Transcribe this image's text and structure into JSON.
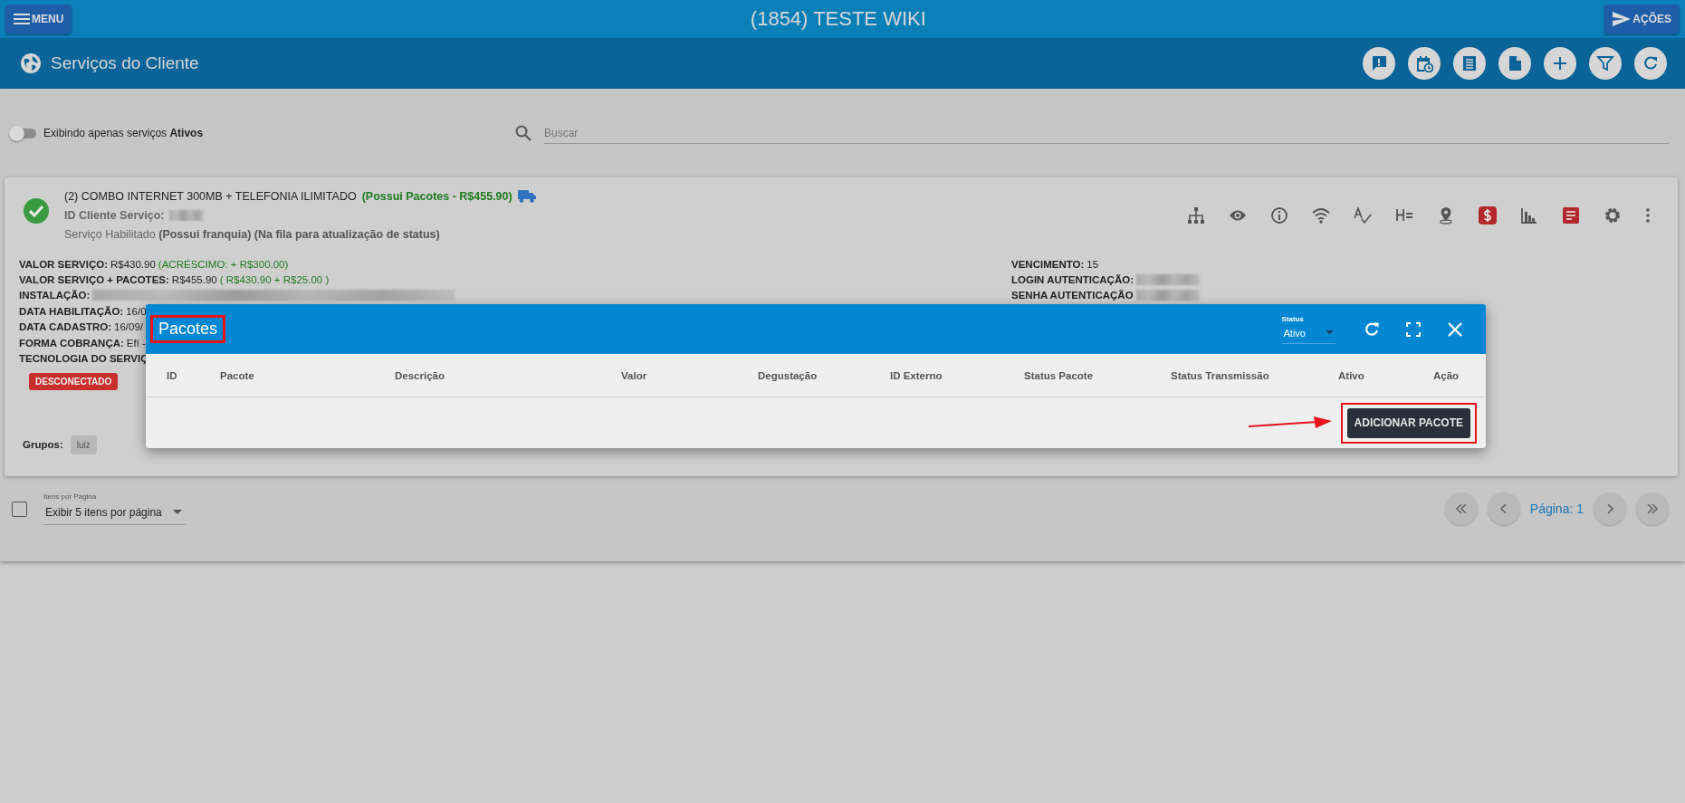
{
  "top_bar": {
    "menu_button": "MENU",
    "title": "(1854) TESTE WIKI",
    "actions_button": "AÇÕES"
  },
  "header": {
    "title": "Serviços do Cliente"
  },
  "filters": {
    "toggle": {
      "label": "Exibindo apenas serviços **Ativos**",
      "on": false
    },
    "search": {
      "placeholder": "Buscar"
    }
  },
  "service": {
    "title": "(2) COMBO INTERNET 300MB + TELEFONIA ILIMITADO",
    "packages_note": "(Possui Pacotes - R$455.90)",
    "id_label": "ID Cliente Serviço:",
    "status_text": "Serviço Habilitado **(Possui franquia) (Na fila para atualização de status)**",
    "left_details": [
      {
        "label": "VALOR SERVIÇO:",
        "value": "R$430.90",
        "note": "(ACRÉSCIMO: + R$300.00)"
      },
      {
        "label": "VALOR SERVIÇO + PACOTES:",
        "value": "R$455.90",
        "note": "( R$430.90 + R$25.00 )"
      },
      {
        "label": "INSTALAÇÃO:",
        "redacted": true
      },
      {
        "label": "DATA HABILITAÇÃO:",
        "value": "16/0"
      },
      {
        "label": "DATA CADASTRO:",
        "value": "16/09/"
      },
      {
        "label": "FORMA COBRANÇA:",
        "value": "Efí -"
      },
      {
        "label": "TECNOLOGIA DO SERVIÇ"
      }
    ],
    "right_details": [
      {
        "label": "VENCIMENTO:",
        "value": "15"
      },
      {
        "label": "LOGIN AUTENTICAÇÃO:",
        "redacted": true
      },
      {
        "label": "SENHA AUTENTICAÇÃO",
        "redacted": true
      }
    ],
    "connection_badge": "DESCONECTADO",
    "groups_label": "Grupos:",
    "groups": [
      "luiz"
    ]
  },
  "pagination": {
    "select_all_checked": false,
    "select_label": "Itens por Página",
    "select_value": "Exibir 5 itens por página",
    "page": "Página: 1"
  },
  "modal": {
    "title": "Pacotes",
    "status_filter": {
      "label": "Status",
      "value": "Ativo"
    },
    "columns": [
      "ID",
      "Pacote",
      "Descrição",
      "Valor",
      "Degustação",
      "ID Externo",
      "Status Pacote",
      "Status Transmissão",
      "Ativo",
      "Ação"
    ],
    "add_button": "ADICIONAR PACOTE"
  }
}
